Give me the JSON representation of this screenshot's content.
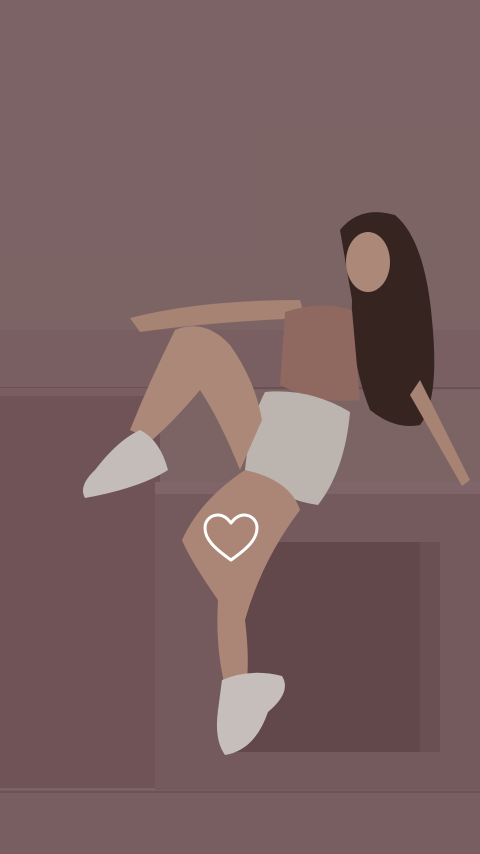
{
  "story": {
    "media_type": "photo",
    "overlay_icon": "heart-outline-icon",
    "colors": {
      "backdrop": "#8d7273",
      "box": "#93696a",
      "heart_stroke": "#ffffff"
    }
  }
}
